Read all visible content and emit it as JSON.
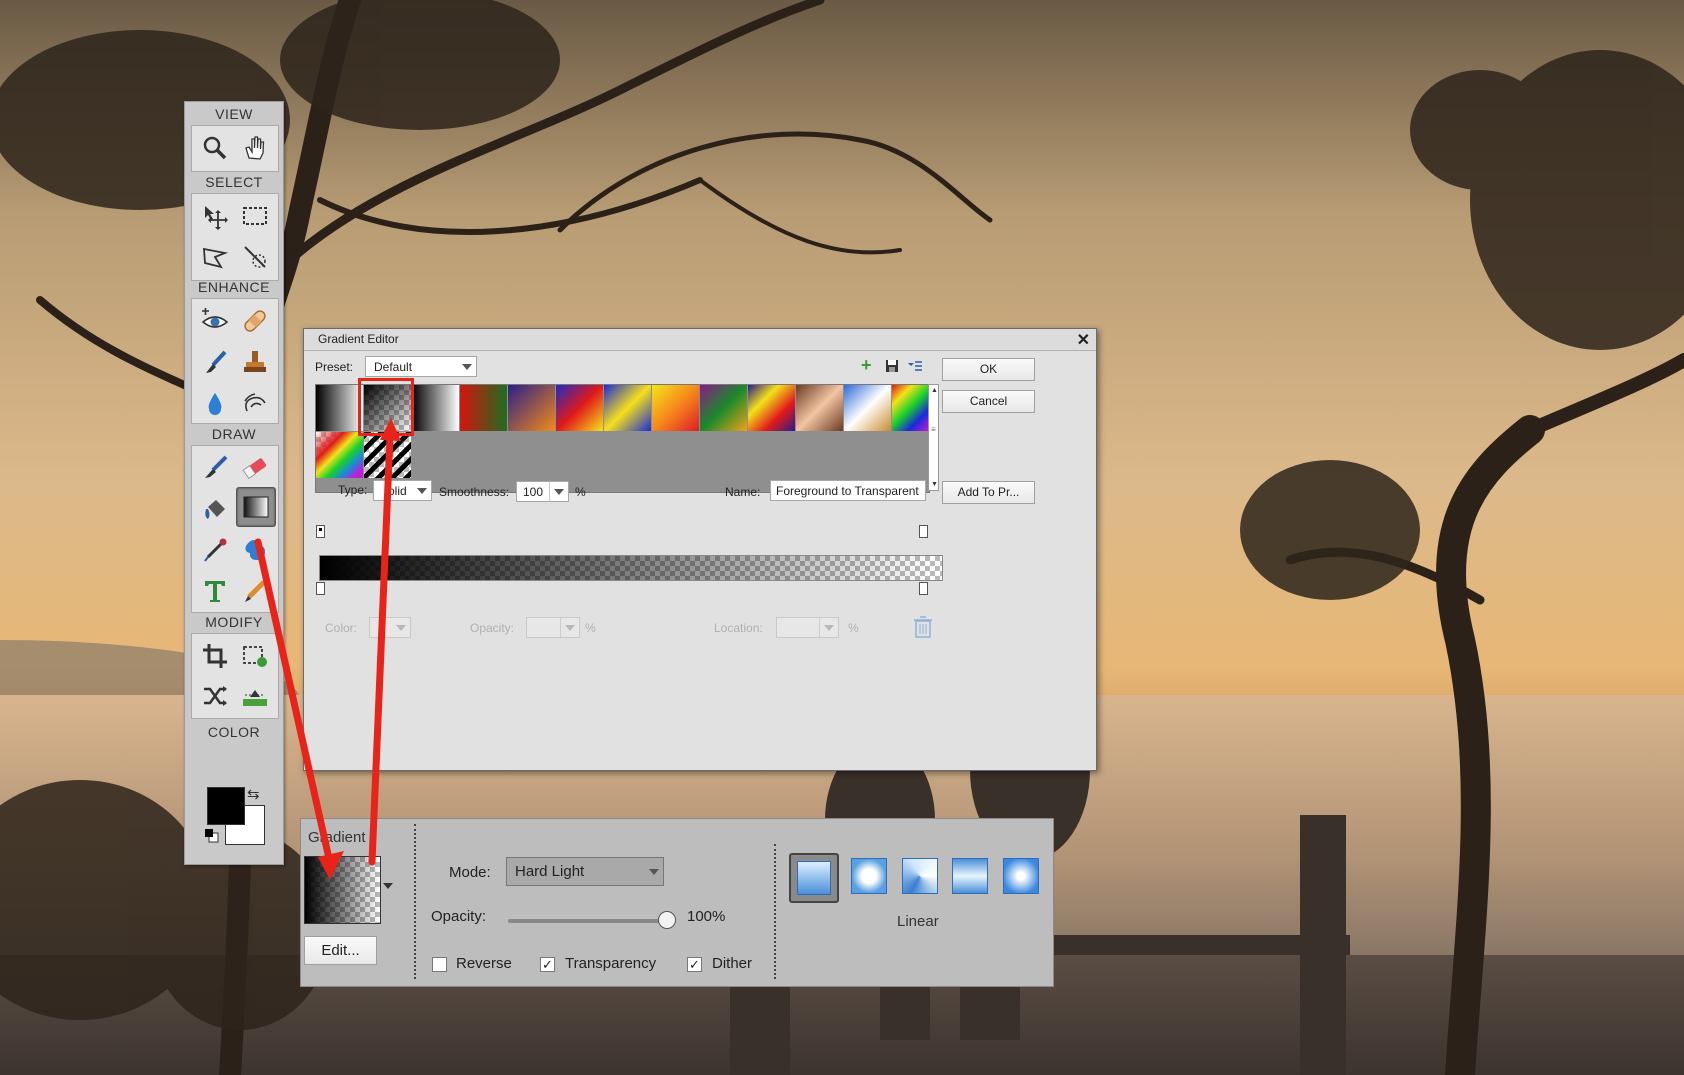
{
  "toolbox": {
    "sections": {
      "view": "VIEW",
      "select": "SELECT",
      "enhance": "ENHANCE",
      "draw": "DRAW",
      "modify": "MODIFY",
      "color": "COLOR"
    },
    "tools": {
      "view": [
        "zoom-icon",
        "hand-icon"
      ],
      "select": [
        "move-icon",
        "marquee-icon",
        "lasso-icon",
        "quick-selection-icon"
      ],
      "enhance": [
        "red-eye-icon",
        "healing-brush-icon",
        "smart-brush-icon",
        "clone-stamp-icon",
        "blur-icon",
        "smudge-icon"
      ],
      "draw": [
        "brush-icon",
        "eraser-icon",
        "paint-bucket-icon",
        "gradient-icon",
        "eyedropper-icon",
        "custom-shape-icon",
        "type-icon",
        "pencil-icon"
      ],
      "modify": [
        "crop-icon",
        "recompose-icon",
        "content-aware-move-icon",
        "straighten-icon"
      ]
    },
    "selected_tool": "gradient-icon",
    "foreground_color": "#000000",
    "background_color": "#ffffff"
  },
  "gradient_editor": {
    "title": "Gradient Editor",
    "preset_label": "Preset:",
    "preset_value": "Default",
    "ok_label": "OK",
    "cancel_label": "Cancel",
    "type_label": "Type:",
    "type_value": "olid",
    "smoothness_label": "Smoothness:",
    "smoothness_value": "100",
    "percent": "%",
    "name_label": "Name:",
    "name_value": "Foreground to Transparent",
    "add_to_presets_label": "Add To Pr...",
    "color_label": "Color:",
    "opacity_label": "Opacity:",
    "location_label": "Location:",
    "selected_preset_index": 1
  },
  "options_bar": {
    "gradient_label": "Gradient",
    "edit_label": "Edit...",
    "mode_label": "Mode:",
    "mode_value": "Hard Light",
    "opacity_label": "Opacity:",
    "opacity_value": "100%",
    "opacity_fraction": 1.0,
    "reverse_label": "Reverse",
    "reverse_checked": false,
    "transparency_label": "Transparency",
    "transparency_checked": true,
    "dither_label": "Dither",
    "dither_checked": true,
    "gradient_types": [
      "linear",
      "radial",
      "angle",
      "reflected",
      "diamond"
    ],
    "selected_type_label": "Linear"
  },
  "colors": {
    "annotation": "#e8231a",
    "accent": "#4a8fd6"
  }
}
